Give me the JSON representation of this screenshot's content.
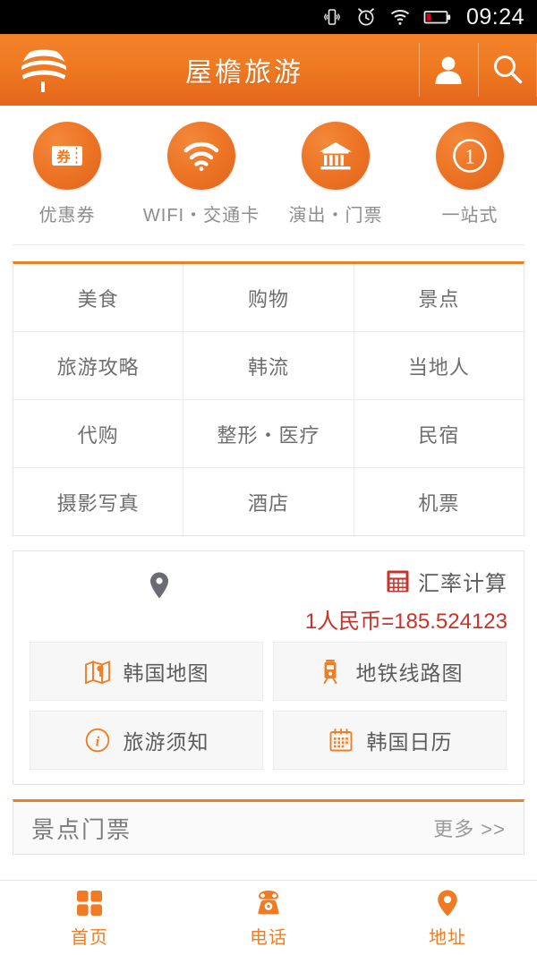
{
  "status_bar": {
    "time": "09:24",
    "icons": [
      "vibrate-icon",
      "alarm-icon",
      "wifi-icon",
      "battery-low-icon"
    ],
    "battery_color": "#d0021b"
  },
  "header": {
    "title": "屋檐旅游",
    "logo_name": "app-logo-globe-wave",
    "accent": "#ef7f26",
    "actions": [
      "user-icon",
      "search-icon"
    ]
  },
  "quick_actions": [
    {
      "label": "优惠券",
      "icon": "coupon-ticket-icon"
    },
    {
      "label": "WIFI・交通卡",
      "icon": "wifi-icon"
    },
    {
      "label": "演出・门票",
      "icon": "bank-building-icon"
    },
    {
      "label": "一站式",
      "icon": "number-one-circle-icon"
    }
  ],
  "category_grid": {
    "top_border_color": "#ef7f26",
    "rows": [
      [
        "美食",
        "购物",
        "景点"
      ],
      [
        "旅游攻略",
        "韩流",
        "当地人"
      ],
      [
        "代购",
        "整形・医疗",
        "民宿"
      ],
      [
        "摄影写真",
        "酒店",
        "机票"
      ]
    ]
  },
  "tools": {
    "location": {
      "icon": "map-pin-icon",
      "label": ""
    },
    "rate": {
      "icon": "calculator-icon",
      "icon_color": "#c9332b",
      "title": "汇率计算",
      "value": "1人民币=185.524123",
      "value_color": "#c9332b"
    },
    "buttons": [
      {
        "label": "韩国地图",
        "icon": "folded-map-icon"
      },
      {
        "label": "地铁线路图",
        "icon": "subway-train-icon"
      },
      {
        "label": "旅游须知",
        "icon": "info-circle-icon"
      },
      {
        "label": "韩国日历",
        "icon": "calendar-icon"
      }
    ]
  },
  "section": {
    "title": "景点门票",
    "more_label": "更多 >>"
  },
  "tabbar": [
    {
      "label": "首页",
      "icon": "grid-home-icon",
      "active": true
    },
    {
      "label": "电话",
      "icon": "telephone-icon",
      "active": false
    },
    {
      "label": "地址",
      "icon": "map-pin-icon",
      "active": false
    }
  ]
}
